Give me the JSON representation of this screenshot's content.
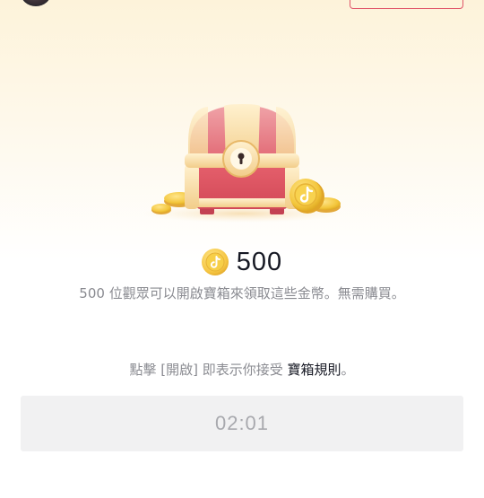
{
  "reward": {
    "coin_icon": "tiktok-coin-icon",
    "amount": "500"
  },
  "description": "500 位觀眾可以開啟寶箱來領取這些金幣。無需購買。",
  "terms": {
    "prefix": "點擊 [開啟] 即表示你接受 ",
    "link": "寶箱規則",
    "suffix": "。"
  },
  "open_button": {
    "countdown": "02:01"
  },
  "colors": {
    "accent_red": "#e0566a",
    "coin_gold": "#f5c542",
    "text_dark": "#161823",
    "text_gray": "#8a8b91",
    "button_bg": "#f1f1f2"
  }
}
